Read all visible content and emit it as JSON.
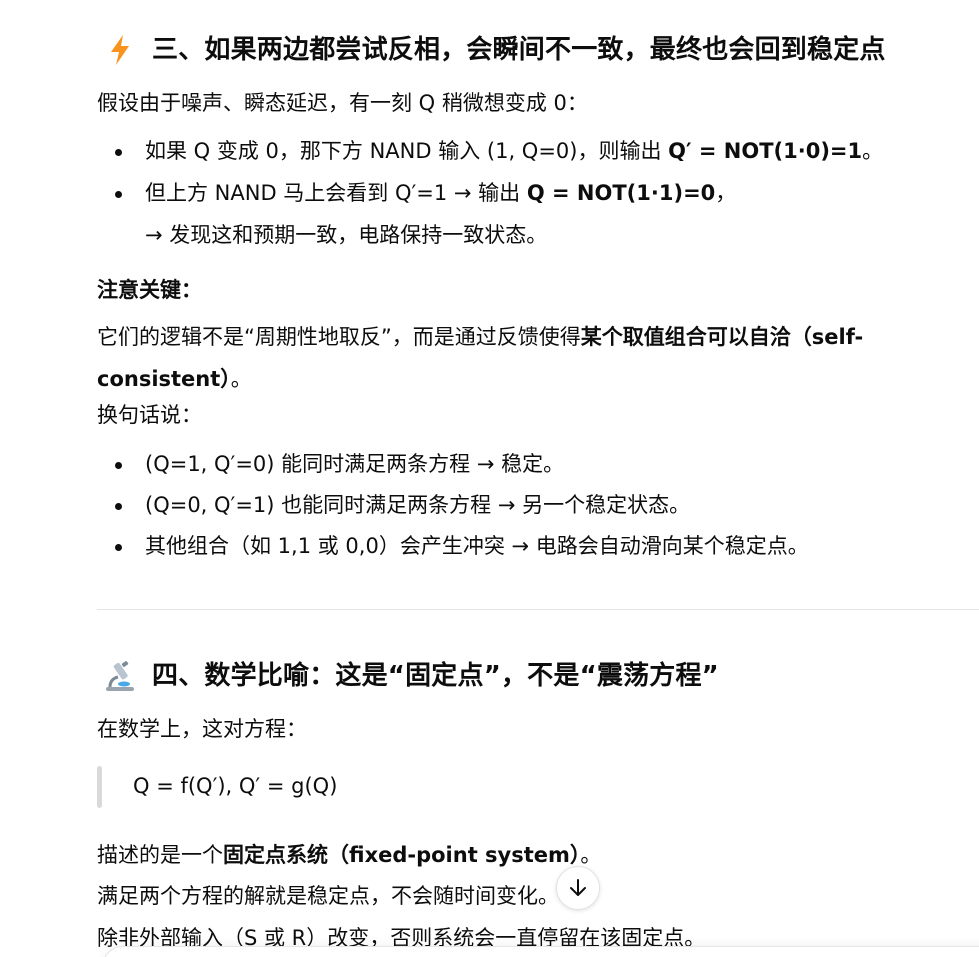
{
  "section3": {
    "icon": "lightning-icon",
    "title": "三、如果两边都尝试反相，会瞬间不一致，最终也会回到稳定点",
    "intro": "假设由于噪声、瞬态延迟，有一刻 Q 稍微想变成 0：",
    "bullet1_pre": "如果 Q 变成 0，那下方 NAND 输入 (1, Q=0)，则输出 ",
    "bullet1_bold": "Q′ = NOT(1·0)=1",
    "bullet1_post": "。",
    "bullet2_pre": "但上方 NAND 马上会看到 Q′=1 → 输出 ",
    "bullet2_bold": "Q = NOT(1·1)=0",
    "bullet2_post": "，",
    "bullet2_line2": "→ 发现这和预期一致，电路保持一致状态。",
    "note_label": "注意关键：",
    "note_pre": "它们的逻辑不是“周期性地取反”，而是通过反馈使得",
    "note_bold_line1": "某个取值组合可以自洽（self-",
    "note_bold_line2": "consistent）",
    "note_post": "。",
    "in_other_words": "换句话说：",
    "bullets2": [
      "(Q=1, Q′=0) 能同时满足两条方程 → 稳定。",
      "(Q=0, Q′=1) 也能同时满足两条方程 → 另一个稳定状态。",
      "其他组合（如 1,1 或 0,0）会产生冲突 → 电路会自动滑向某个稳定点。"
    ]
  },
  "section4": {
    "icon": "microscope-icon",
    "title": "四、数学比喻：这是“固定点”，不是“震荡方程”",
    "intro": "在数学上，这对方程：",
    "quote": "Q = f(Q′), Q′ = g(Q)",
    "desc_pre": "描述的是一个",
    "desc_bold": "固定点系统（fixed-point system）",
    "desc_post": "。",
    "line2": "满足两个方程的解就是稳定点，不会随时间变化。",
    "line3": "除非外部输入（S 或 R）改变，否则系统会一直停留在该固定点。"
  },
  "ui": {
    "scroll_down_icon": "arrow-down-icon",
    "accent_color": "#f7931e"
  }
}
